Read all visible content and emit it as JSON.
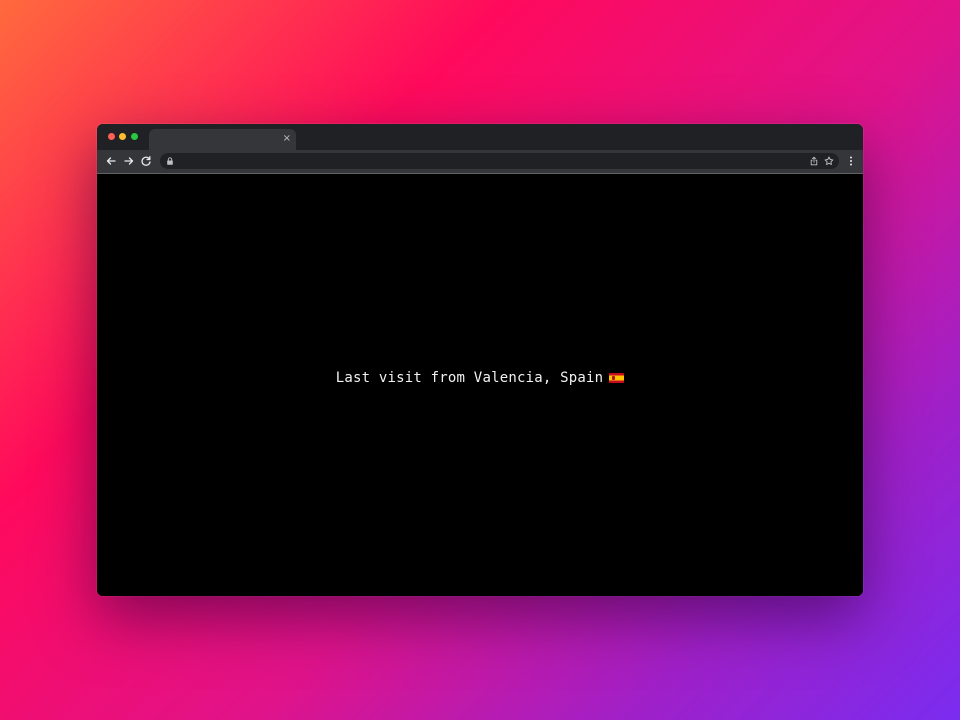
{
  "browser": {
    "tab": {
      "title": "",
      "close_glyph": "×"
    },
    "address_bar": {
      "url": "",
      "icons": [
        "lock-icon",
        "share-icon",
        "bookmark-star-icon"
      ]
    },
    "nav_icons": [
      "back-arrow-icon",
      "forward-arrow-icon",
      "reload-icon",
      "menu-icon"
    ]
  },
  "page": {
    "message": "Last visit from Valencia, Spain",
    "flag_icon": "spain-flag-icon"
  },
  "colors": {
    "window_frame": "#202124",
    "toolbar": "#35363a",
    "page_background": "#000000",
    "message_text": "#f1f1f1"
  }
}
